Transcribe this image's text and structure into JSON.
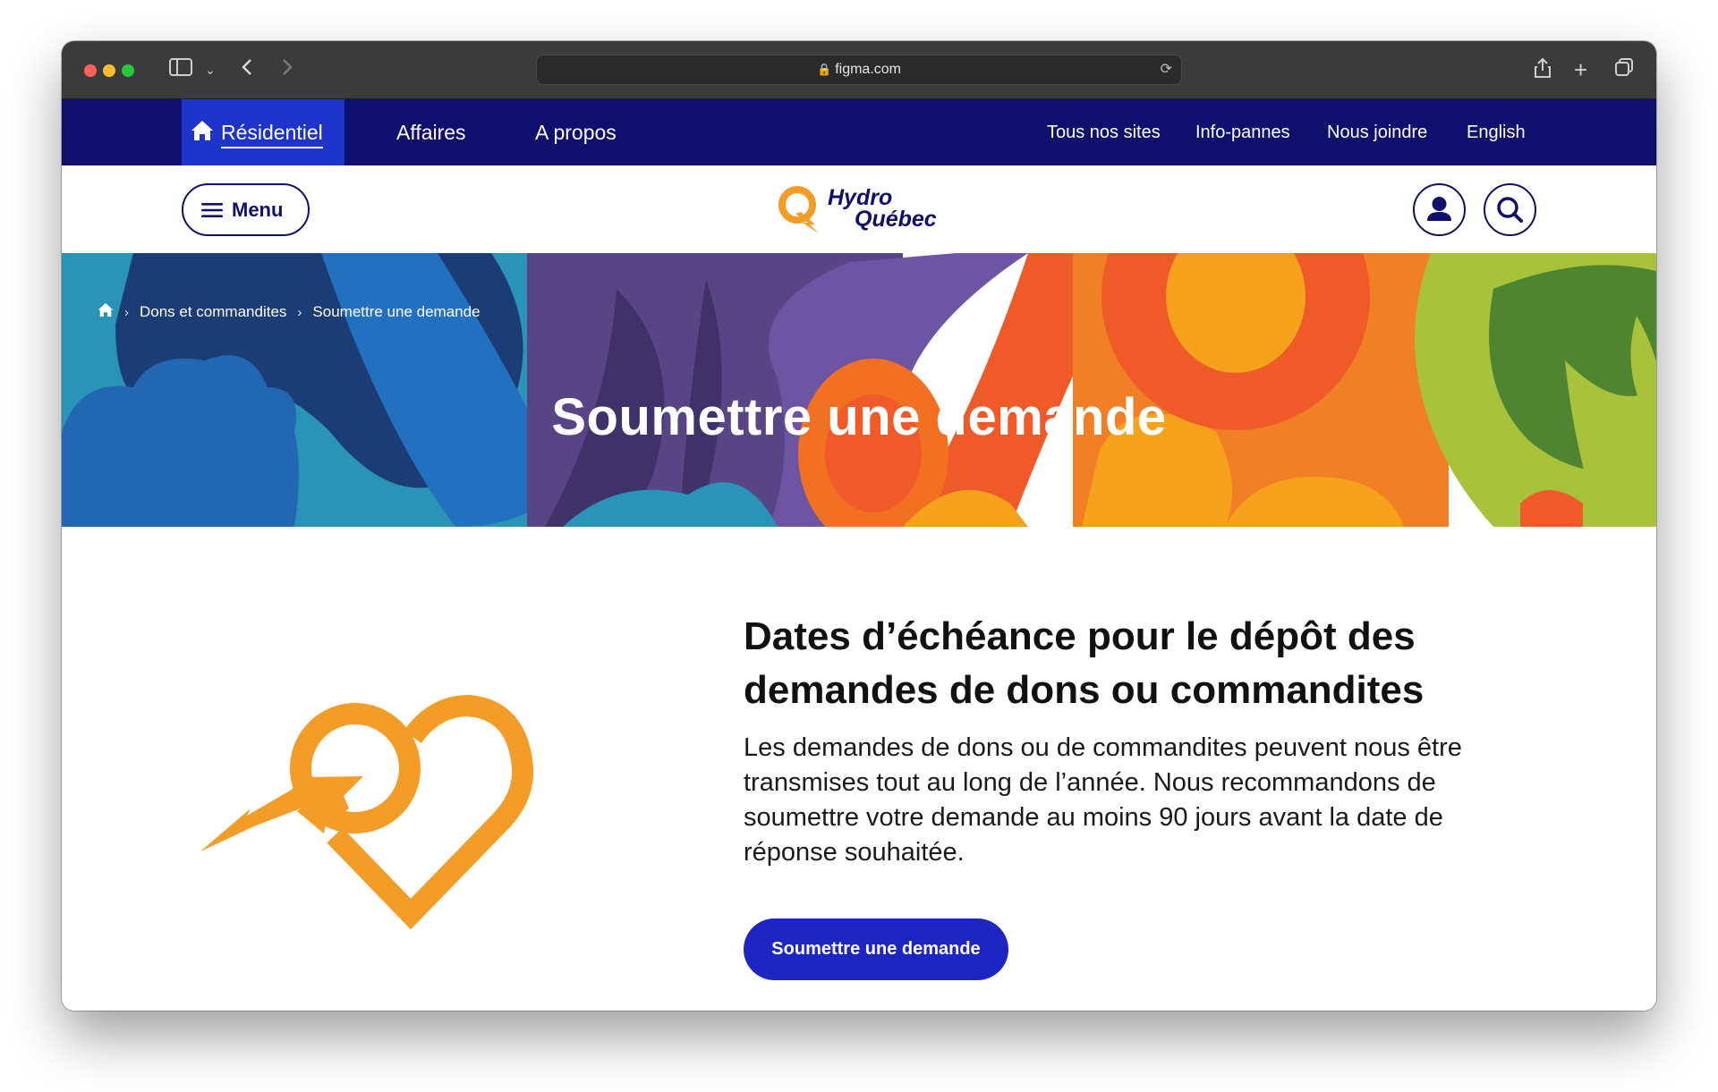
{
  "browser": {
    "url": "figma.com"
  },
  "topnav": {
    "tabs": [
      {
        "label": "Résidentiel",
        "active": true
      },
      {
        "label": "Affaires"
      },
      {
        "label": "A propos"
      }
    ],
    "utility_links": [
      "Tous nos sites",
      "Info-pannes",
      "Nous joindre",
      "English"
    ]
  },
  "header": {
    "menu_label": "Menu",
    "logo_line1": "Hydro",
    "logo_line2": "Québec"
  },
  "hero": {
    "breadcrumb": [
      "Dons et commandites",
      "Soumettre une demande"
    ],
    "title": "Soumettre une demande"
  },
  "content": {
    "heading": "Dates d’échéance pour le dépôt des demandes de dons ou commandites",
    "body": "Les demandes de dons ou de commandites peuvent nous être transmises tout au long de l’année. Nous recommandons de soumettre votre demande au moins 90 jours avant la date de réponse souhaitée.",
    "cta_label": "Soumettre une demande"
  },
  "colors": {
    "nav_bg": "#0f0f6e",
    "active_tab": "#1d33c9",
    "brand_orange": "#f39c28",
    "cta_bg": "#1d26c2"
  },
  "icons": [
    "home-icon",
    "menu-icon",
    "user-icon",
    "search-icon",
    "lock-icon",
    "chevron-right-icon"
  ]
}
